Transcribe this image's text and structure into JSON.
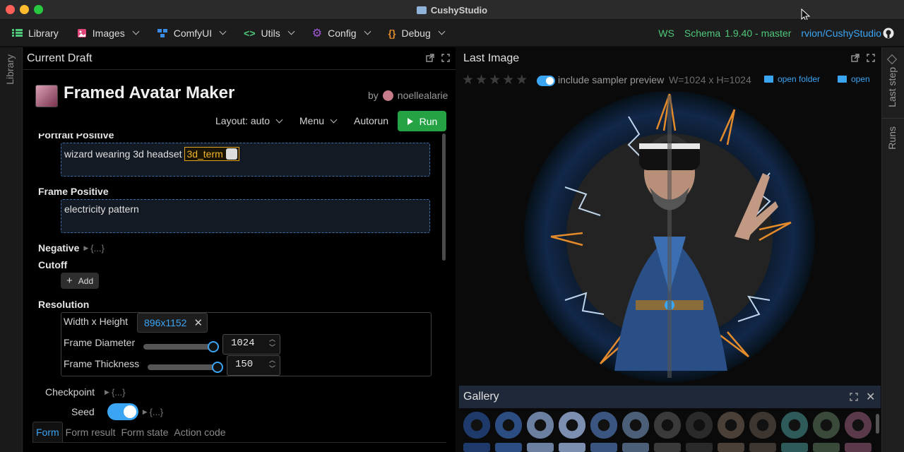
{
  "window": {
    "title": "CushyStudio"
  },
  "menubar": {
    "items": [
      {
        "label": "Library"
      },
      {
        "label": "Images"
      },
      {
        "label": "ComfyUI"
      },
      {
        "label": "Utils"
      },
      {
        "label": "Config"
      },
      {
        "label": "Debug"
      }
    ],
    "status": {
      "ws": "WS",
      "schema": "Schema",
      "version": "1.9.40 - master",
      "repo": "rvion/CushyStudio"
    }
  },
  "left_rail": {
    "label": "Library"
  },
  "right_rail": {
    "last_step": "Last step",
    "runs": "Runs"
  },
  "draft": {
    "panel_title": "Current Draft",
    "app_title": "Framed Avatar Maker",
    "by": "by",
    "author": "noellealarie",
    "layout_label": "Layout: auto",
    "menu_label": "Menu",
    "autorun_label": "Autorun",
    "run_label": "Run",
    "portrait_label": "Portrait Positive",
    "portrait_text": "wizard wearing 3d headset",
    "portrait_tag": "3d_term",
    "frame_label": "Frame Positive",
    "frame_text": "electricity pattern",
    "negative_label": "Negative",
    "negative_collapsed": "{...}",
    "cutoff_label": "Cutoff",
    "add_label": "Add",
    "resolution_label": "Resolution",
    "wh_label": "Width x Height",
    "wh_value": "896x1152",
    "frame_diameter_label": "Frame Diameter",
    "frame_diameter_value": "1024",
    "frame_diameter_level": 1.0,
    "frame_thickness_label": "Frame Thickness",
    "frame_thickness_value": "150",
    "frame_thickness_level": 1.0,
    "checkpoint_label": "Checkpoint",
    "checkpoint_collapsed": "{...}",
    "seed_label": "Seed",
    "seed_collapsed": "{...}",
    "tabs": [
      "Form",
      "Form result",
      "Form state",
      "Action code"
    ]
  },
  "last_image": {
    "panel_title": "Last Image",
    "rating": 0,
    "stars_total": 5,
    "sampler_label": "include sampler preview",
    "dims": "W=1024 x H=1024",
    "open_folder": "open folder",
    "open": "open"
  },
  "gallery": {
    "title": "Gallery"
  },
  "colors": {
    "accent": "#3ba5f4",
    "run": "#25a244",
    "tag": "#e0a422",
    "gallery_header": "#1e2838"
  }
}
